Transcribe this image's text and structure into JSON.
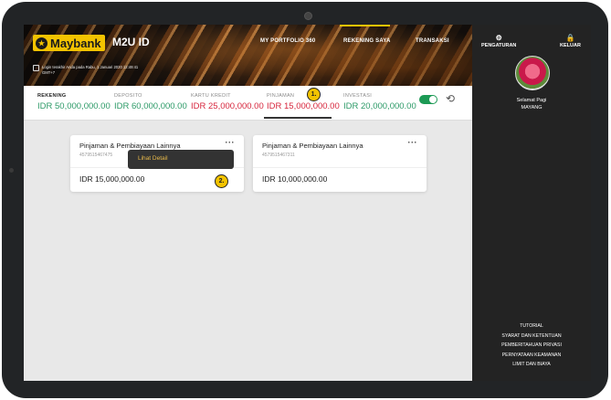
{
  "brand": {
    "logo_text": "Maybank",
    "app_name": "M2U ID"
  },
  "nav": {
    "items": [
      "MY PORTFOLIO 360",
      "REKENING SAYA",
      "TRANSAKSI"
    ],
    "active": "REKENING SAYA"
  },
  "login_info": {
    "line1": "Login terakhir Anda pada Rabu, 1 Januari 2020 12:49:41",
    "line2": "GMT+7"
  },
  "tabs": [
    {
      "label": "REKENING",
      "value": "IDR 50,000,000.00",
      "color": "green"
    },
    {
      "label": "DEPOSITO",
      "value": "IDR 60,000,000.00",
      "color": "green"
    },
    {
      "label": "KARTU KREDIT",
      "value": "IDR 25,000,000.00",
      "color": "red"
    },
    {
      "label": "PINJAMAN",
      "value": "IDR 15,000,000.00",
      "color": "red"
    },
    {
      "label": "INVESTASI",
      "value": "IDR 20,000,000.00",
      "color": "green"
    }
  ],
  "markers": {
    "m1": "1.",
    "m2": "2."
  },
  "cards": [
    {
      "title": "Pinjaman & Pembiayaan Lainnya",
      "account": "4579515467475",
      "amount": "IDR 15,000,000.00"
    },
    {
      "title": "Pinjaman & Pembiayaan Lainnya",
      "account": "4579515467311",
      "amount": "IDR 10,000,000.00"
    }
  ],
  "popup": {
    "label": "Lihat Detail"
  },
  "sidebar": {
    "settings": "PENGATURAN",
    "logout": "KELUAR",
    "greeting": "Selamat Pagi",
    "user": "MAYANG",
    "links": [
      "TUTORIAL",
      "SYARAT DAN KETENTUAN",
      "PEMBERITAHUAN PRIVASI",
      "PERNYATAAN KEAMANAN",
      "LIMIT DAN BIAYA"
    ]
  },
  "colors": {
    "accent": "#f3c300",
    "positive": "#2c9a67",
    "negative": "#d7263d",
    "toggle": "#1c9a55"
  }
}
